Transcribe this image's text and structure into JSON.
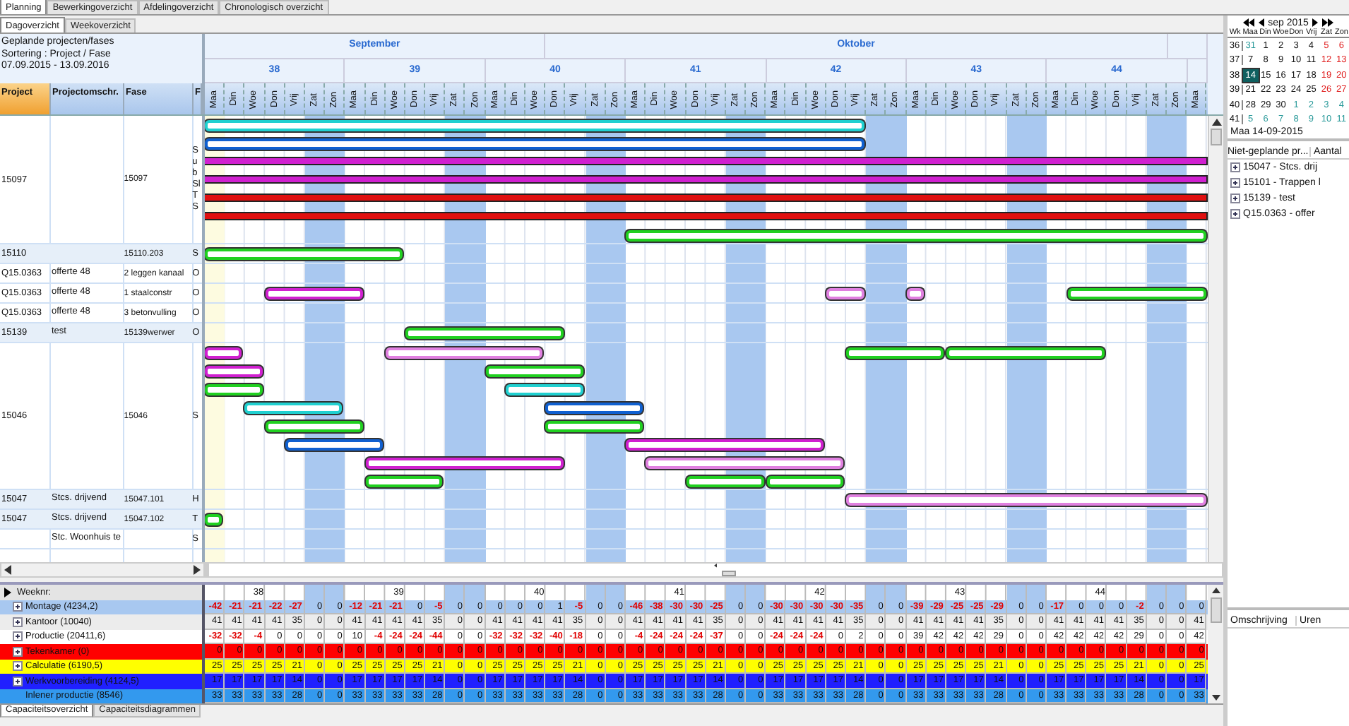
{
  "top_tabs": [
    {
      "label": "Planning",
      "selected": true
    },
    {
      "label": "Bewerkingoverzicht",
      "selected": false
    },
    {
      "label": "Afdelingoverzicht",
      "selected": false
    },
    {
      "label": "Chronologisch overzicht",
      "selected": false
    }
  ],
  "sub_tabs": [
    {
      "label": "Dagoverzicht",
      "selected": true
    },
    {
      "label": "Weekoverzicht",
      "selected": false
    }
  ],
  "info": [
    "Geplande projecten/fases",
    "Sortering : Project / Fase",
    "07.09.2015 - 13.09.2016"
  ],
  "columns": [
    {
      "label": "Project",
      "sorted": true
    },
    {
      "label": "Projectomschr.",
      "sorted": false
    },
    {
      "label": "Fase",
      "sorted": false
    },
    {
      "label": "F",
      "sorted": false
    }
  ],
  "gantt": {
    "months": [
      "September",
      "Oktober"
    ],
    "weeks": [
      "38",
      "39",
      "40",
      "41",
      "42",
      "43",
      "44"
    ],
    "days": [
      {
        "label": "Maa",
        "weekend": false,
        "highlighted": true
      },
      {
        "label": "Din",
        "weekend": false,
        "highlighted": false
      },
      {
        "label": "Woe",
        "weekend": false,
        "highlighted": false
      },
      {
        "label": "Don",
        "weekend": false,
        "highlighted": false
      },
      {
        "label": "Vrij",
        "weekend": false,
        "highlighted": false
      },
      {
        "label": "Zat",
        "weekend": true,
        "highlighted": false
      },
      {
        "label": "Zon",
        "weekend": true,
        "highlighted": false
      },
      {
        "label": "Maa",
        "weekend": false,
        "highlighted": false
      },
      {
        "label": "Din",
        "weekend": false,
        "highlighted": false
      },
      {
        "label": "Woe",
        "weekend": false,
        "highlighted": false
      },
      {
        "label": "Don",
        "weekend": false,
        "highlighted": false
      },
      {
        "label": "Vrij",
        "weekend": false,
        "highlighted": false
      },
      {
        "label": "Zat",
        "weekend": true,
        "highlighted": false
      },
      {
        "label": "Zon",
        "weekend": true,
        "highlighted": false
      },
      {
        "label": "Maa",
        "weekend": false,
        "highlighted": false
      },
      {
        "label": "Din",
        "weekend": false,
        "highlighted": false
      },
      {
        "label": "Woe",
        "weekend": false,
        "highlighted": false
      },
      {
        "label": "Don",
        "weekend": false,
        "highlighted": false
      },
      {
        "label": "Vrij",
        "weekend": false,
        "highlighted": false
      },
      {
        "label": "Zat",
        "weekend": true,
        "highlighted": false
      },
      {
        "label": "Zon",
        "weekend": true,
        "highlighted": false
      },
      {
        "label": "Maa",
        "weekend": false,
        "highlighted": false
      },
      {
        "label": "Din",
        "weekend": false,
        "highlighted": false
      },
      {
        "label": "Woe",
        "weekend": false,
        "highlighted": false
      },
      {
        "label": "Don",
        "weekend": false,
        "highlighted": false
      },
      {
        "label": "Vrij",
        "weekend": false,
        "highlighted": false
      },
      {
        "label": "Zat",
        "weekend": true,
        "highlighted": false
      },
      {
        "label": "Zon",
        "weekend": true,
        "highlighted": false
      },
      {
        "label": "Maa",
        "weekend": false,
        "highlighted": false
      },
      {
        "label": "Din",
        "weekend": false,
        "highlighted": false
      },
      {
        "label": "Woe",
        "weekend": false,
        "highlighted": false
      },
      {
        "label": "Don",
        "weekend": false,
        "highlighted": false
      },
      {
        "label": "Vrij",
        "weekend": false,
        "highlighted": false
      },
      {
        "label": "Zat",
        "weekend": true,
        "highlighted": false
      },
      {
        "label": "Zon",
        "weekend": true,
        "highlighted": false
      },
      {
        "label": "Maa",
        "weekend": false,
        "highlighted": false
      },
      {
        "label": "Din",
        "weekend": false,
        "highlighted": false
      },
      {
        "label": "Woe",
        "weekend": false,
        "highlighted": false
      },
      {
        "label": "Don",
        "weekend": false,
        "highlighted": false
      },
      {
        "label": "Vrij",
        "weekend": false,
        "highlighted": false
      },
      {
        "label": "Zat",
        "weekend": true,
        "highlighted": false
      },
      {
        "label": "Zon",
        "weekend": true,
        "highlighted": false
      },
      {
        "label": "Maa",
        "weekend": false,
        "highlighted": false
      },
      {
        "label": "Din",
        "weekend": false,
        "highlighted": false
      },
      {
        "label": "Woe",
        "weekend": false,
        "highlighted": false
      },
      {
        "label": "Don",
        "weekend": false,
        "highlighted": false
      },
      {
        "label": "Vrij",
        "weekend": false,
        "highlighted": false
      },
      {
        "label": "Zat",
        "weekend": true,
        "highlighted": false
      },
      {
        "label": "Zon",
        "weekend": true,
        "highlighted": false
      },
      {
        "label": "Maa",
        "weekend": false,
        "highlighted": false
      }
    ]
  },
  "rows": [
    {
      "project": "15097",
      "phase": "15097",
      "column_4": [
        "S",
        "u",
        "b",
        "Sl",
        "T",
        "S"
      ],
      "shaded": false
    },
    {
      "project": "15110",
      "phase": "15110.203",
      "column_4": [
        "S"
      ],
      "shaded": true
    },
    {
      "project": "Q15.0363",
      "description": "offerte 48",
      "phase": "2 leggen kanaal",
      "column_4": [
        "O"
      ],
      "shaded": false
    },
    {
      "project": "Q15.0363",
      "description": "offerte 48",
      "phase": "1 staalconstr",
      "column_4": [
        "O"
      ],
      "shaded": false
    },
    {
      "project": "Q15.0363",
      "description": "offerte 48",
      "phase": "3 betonvulling",
      "column_4": [
        "O"
      ],
      "shaded": false
    },
    {
      "project": "15139",
      "description": "test",
      "phase": "15139werwer",
      "column_4": [
        "O"
      ],
      "shaded": true
    },
    {
      "project": "15046",
      "phase": "15046",
      "column_4": [
        "S"
      ],
      "shaded": false
    },
    {
      "project": "15047",
      "description": "Stcs. drijvend",
      "phase": "15047.101",
      "column_4": [
        "H"
      ],
      "shaded": true
    },
    {
      "project": "15047",
      "description": "Stcs. drijvend",
      "phase": "15047.102",
      "column_4": [
        "T"
      ],
      "shaded": true
    },
    {
      "description": "Stc. Woonhuis te",
      "column_4": [
        "S"
      ],
      "shaded": false
    }
  ],
  "capacity": {
    "week_label": "Weeknr:",
    "weeks": [
      "38",
      "39",
      "40",
      "41",
      "42",
      "43",
      "44"
    ],
    "rows": [
      {
        "label": "Montage (4234,2)",
        "color": "#a8c8f0",
        "expandable": true,
        "values": [
          "-42",
          "-21",
          "-21",
          "-22",
          "-27",
          "0",
          "0",
          "-12",
          "-21",
          "-21",
          "0",
          "-5",
          "0",
          "0",
          "0",
          "0",
          "0",
          "1",
          "-5",
          "0",
          "0",
          "-46",
          "-38",
          "-30",
          "-30",
          "-25",
          "0",
          "0",
          "-30",
          "-30",
          "-30",
          "-30",
          "-35",
          "0",
          "0",
          "-39",
          "-29",
          "-25",
          "-25",
          "-29",
          "0",
          "0",
          "-17",
          "0",
          "0",
          "0",
          "-2",
          "0",
          "0",
          "0"
        ]
      },
      {
        "label": "Kantoor (10040)",
        "color": "#ececec",
        "expandable": true,
        "values": [
          "41",
          "41",
          "41",
          "41",
          "35",
          "0",
          "0",
          "41",
          "41",
          "41",
          "41",
          "35",
          "0",
          "0",
          "41",
          "41",
          "41",
          "41",
          "35",
          "0",
          "0",
          "41",
          "41",
          "41",
          "41",
          "35",
          "0",
          "0",
          "41",
          "41",
          "41",
          "41",
          "35",
          "0",
          "0",
          "41",
          "41",
          "41",
          "41",
          "35",
          "0",
          "0",
          "41",
          "41",
          "41",
          "41",
          "35",
          "0",
          "0",
          "41"
        ]
      },
      {
        "label": "Productie (20411,6)",
        "color": "#ffffff",
        "expandable": true,
        "values": [
          "-32",
          "-32",
          "-4",
          "0",
          "0",
          "0",
          "0",
          "10",
          "-4",
          "-24",
          "-24",
          "-44",
          "0",
          "0",
          "-32",
          "-32",
          "-32",
          "-40",
          "-18",
          "0",
          "0",
          "-4",
          "-24",
          "-24",
          "-24",
          "-37",
          "0",
          "0",
          "-24",
          "-24",
          "-24",
          "0",
          "2",
          "0",
          "0",
          "39",
          "42",
          "42",
          "42",
          "29",
          "0",
          "0",
          "42",
          "42",
          "42",
          "42",
          "29",
          "0",
          "0",
          "42"
        ]
      },
      {
        "label": "Tekenkamer (0)",
        "color": "#ff0000",
        "expandable": true,
        "values": [
          "0",
          "0",
          "0",
          "0",
          "0",
          "0",
          "0",
          "0",
          "0",
          "0",
          "0",
          "0",
          "0",
          "0",
          "0",
          "0",
          "0",
          "0",
          "0",
          "0",
          "0",
          "0",
          "0",
          "0",
          "0",
          "0",
          "0",
          "0",
          "0",
          "0",
          "0",
          "0",
          "0",
          "0",
          "0",
          "0",
          "0",
          "0",
          "0",
          "0",
          "0",
          "0",
          "0",
          "0",
          "0",
          "0",
          "0",
          "0",
          "0",
          "0"
        ]
      },
      {
        "label": "Calculatie (6190,5)",
        "color": "#ffff00",
        "expandable": true,
        "values": [
          "25",
          "25",
          "25",
          "25",
          "21",
          "0",
          "0",
          "25",
          "25",
          "25",
          "25",
          "21",
          "0",
          "0",
          "25",
          "25",
          "25",
          "25",
          "21",
          "0",
          "0",
          "25",
          "25",
          "25",
          "25",
          "21",
          "0",
          "0",
          "25",
          "25",
          "25",
          "25",
          "21",
          "0",
          "0",
          "25",
          "25",
          "25",
          "25",
          "21",
          "0",
          "0",
          "25",
          "25",
          "25",
          "25",
          "21",
          "0",
          "0",
          "25"
        ]
      },
      {
        "label": "Werkvoorbereiding (4124,5)",
        "color": "#2020ff",
        "expandable": true,
        "values": [
          "17",
          "17",
          "17",
          "17",
          "14",
          "0",
          "0",
          "17",
          "17",
          "17",
          "17",
          "14",
          "0",
          "0",
          "17",
          "17",
          "17",
          "17",
          "14",
          "0",
          "0",
          "17",
          "17",
          "17",
          "17",
          "14",
          "0",
          "0",
          "17",
          "17",
          "17",
          "17",
          "14",
          "0",
          "0",
          "17",
          "17",
          "17",
          "17",
          "14",
          "0",
          "0",
          "17",
          "17",
          "17",
          "17",
          "14",
          "0",
          "0",
          "17"
        ]
      },
      {
        "label": "Inlener productie (8546)",
        "color": "#3399ee",
        "expandable": false,
        "values": [
          "33",
          "33",
          "33",
          "33",
          "28",
          "0",
          "0",
          "33",
          "33",
          "33",
          "33",
          "28",
          "0",
          "0",
          "33",
          "33",
          "33",
          "33",
          "28",
          "0",
          "0",
          "33",
          "33",
          "33",
          "33",
          "28",
          "0",
          "0",
          "33",
          "33",
          "33",
          "33",
          "28",
          "0",
          "0",
          "33",
          "33",
          "33",
          "33",
          "28",
          "0",
          "0",
          "33",
          "33",
          "33",
          "33",
          "28",
          "0",
          "0",
          "33"
        ]
      }
    ]
  },
  "bottom_tabs": [
    {
      "label": "Capaciteitsoverzicht",
      "selected": true
    },
    {
      "label": "Capaciteitsdiagrammen",
      "selected": false
    }
  ],
  "calendar": {
    "title": "sep 2015",
    "headers": [
      "Wk",
      "Maa",
      "Din",
      "Woe",
      "Don",
      "Vrij",
      "Zat",
      "Zon"
    ],
    "weeks": [
      {
        "week": "36",
        "days": [
          {
            "t": "31",
            "kind": "other",
            "selected": false
          },
          {
            "t": "1",
            "kind": "day",
            "selected": false
          },
          {
            "t": "2",
            "kind": "day",
            "selected": false
          },
          {
            "t": "3",
            "kind": "day",
            "selected": false
          },
          {
            "t": "4",
            "kind": "day",
            "selected": false
          },
          {
            "t": "5",
            "kind": "weekend",
            "selected": false
          },
          {
            "t": "6",
            "kind": "weekend",
            "selected": false
          }
        ]
      },
      {
        "week": "37",
        "days": [
          {
            "t": "7",
            "kind": "day",
            "selected": false
          },
          {
            "t": "8",
            "kind": "day",
            "selected": false
          },
          {
            "t": "9",
            "kind": "day",
            "selected": false
          },
          {
            "t": "10",
            "kind": "day",
            "selected": false
          },
          {
            "t": "11",
            "kind": "day",
            "selected": false
          },
          {
            "t": "12",
            "kind": "weekend",
            "selected": false
          },
          {
            "t": "13",
            "kind": "weekend",
            "selected": false
          }
        ]
      },
      {
        "week": "38",
        "days": [
          {
            "t": "14",
            "kind": "day",
            "selected": true
          },
          {
            "t": "15",
            "kind": "day",
            "selected": false
          },
          {
            "t": "16",
            "kind": "day",
            "selected": false
          },
          {
            "t": "17",
            "kind": "day",
            "selected": false
          },
          {
            "t": "18",
            "kind": "day",
            "selected": false
          },
          {
            "t": "19",
            "kind": "weekend",
            "selected": false
          },
          {
            "t": "20",
            "kind": "weekend",
            "selected": false
          }
        ]
      },
      {
        "week": "39",
        "days": [
          {
            "t": "21",
            "kind": "day",
            "selected": false
          },
          {
            "t": "22",
            "kind": "day",
            "selected": false
          },
          {
            "t": "23",
            "kind": "day",
            "selected": false
          },
          {
            "t": "24",
            "kind": "day",
            "selected": false
          },
          {
            "t": "25",
            "kind": "day",
            "selected": false
          },
          {
            "t": "26",
            "kind": "weekend",
            "selected": false
          },
          {
            "t": "27",
            "kind": "weekend",
            "selected": false
          }
        ]
      },
      {
        "week": "40",
        "days": [
          {
            "t": "28",
            "kind": "day",
            "selected": false
          },
          {
            "t": "29",
            "kind": "day",
            "selected": false
          },
          {
            "t": "30",
            "kind": "day",
            "selected": false
          },
          {
            "t": "1",
            "kind": "other",
            "selected": false
          },
          {
            "t": "2",
            "kind": "other",
            "selected": false
          },
          {
            "t": "3",
            "kind": "other",
            "selected": false
          },
          {
            "t": "4",
            "kind": "other",
            "selected": false
          }
        ]
      },
      {
        "week": "41",
        "days": [
          {
            "t": "5",
            "kind": "other",
            "selected": false
          },
          {
            "t": "6",
            "kind": "other",
            "selected": false
          },
          {
            "t": "7",
            "kind": "other",
            "selected": false
          },
          {
            "t": "8",
            "kind": "other",
            "selected": false
          },
          {
            "t": "9",
            "kind": "other",
            "selected": false
          },
          {
            "t": "10",
            "kind": "other",
            "selected": false
          },
          {
            "t": "11",
            "kind": "other",
            "selected": false
          }
        ]
      }
    ],
    "footer": "Maa 14-09-2015"
  },
  "unplanned": {
    "headers": [
      "Niet-geplande pr...",
      "Aantal"
    ],
    "items": [
      "15047 - Stcs. drij",
      "15101 - Trappen l",
      "15139 - test",
      "Q15.0363 - offer"
    ]
  },
  "details": {
    "headers": [
      "Omschrijving",
      "Uren"
    ]
  }
}
